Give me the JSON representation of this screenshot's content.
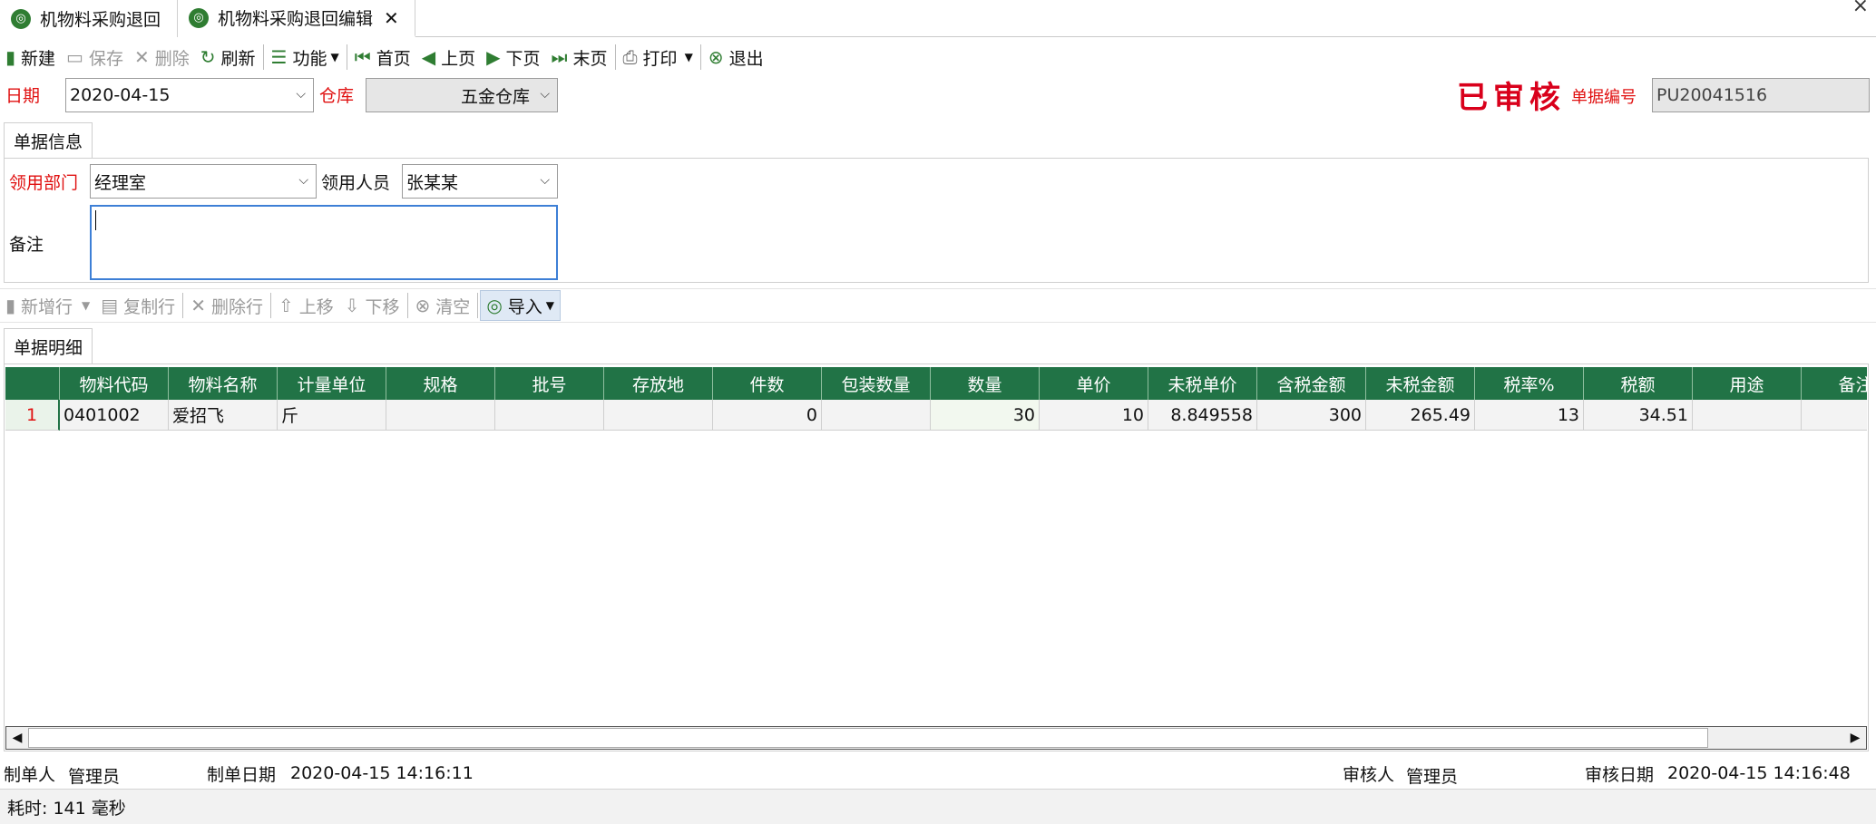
{
  "tabs": [
    {
      "label": "机物料采购退回",
      "active": false
    },
    {
      "label": "机物料采购退回编辑",
      "active": true
    }
  ],
  "toolbar": {
    "new": "新建",
    "save": "保存",
    "delete": "删除",
    "refresh": "刷新",
    "functions": "功能",
    "first": "首页",
    "prev": "上页",
    "next": "下页",
    "last": "末页",
    "print": "打印",
    "exit": "退出"
  },
  "header": {
    "date_label": "日期",
    "date_value": "2020-04-15",
    "warehouse_label": "仓库",
    "warehouse_value": "五金仓库",
    "audited_stamp": "已审核",
    "docno_label": "单据编号",
    "docno_value": "PU20041516"
  },
  "info_section": {
    "tab_label": "单据信息",
    "dept_label": "领用部门",
    "dept_value": "经理室",
    "person_label": "领用人员",
    "person_value": "张某某",
    "remark_label": "备注",
    "remark_value": ""
  },
  "grid_toolbar": {
    "add_row": "新增行",
    "copy_row": "复制行",
    "delete_row": "删除行",
    "move_up": "上移",
    "move_down": "下移",
    "clear": "清空",
    "import": "导入"
  },
  "detail_section": {
    "tab_label": "单据明细",
    "columns": [
      "物料代码",
      "物料名称",
      "计量单位",
      "规格",
      "批号",
      "存放地",
      "件数",
      "包装数量",
      "数量",
      "单价",
      "未税单价",
      "含税金额",
      "未税金额",
      "税率%",
      "税额",
      "用途",
      "备注"
    ],
    "rows": [
      {
        "index": "1",
        "cells": [
          "0401002",
          "爱招飞",
          "斤",
          "",
          "",
          "",
          "0",
          "",
          "30",
          "10",
          "8.849558",
          "300",
          "265.49",
          "13",
          "34.51",
          "",
          ""
        ]
      }
    ]
  },
  "footer": {
    "creator_label": "制单人",
    "creator_value": "管理员",
    "created_label": "制单日期",
    "created_value": "2020-04-15 14:16:11",
    "auditor_label": "审核人",
    "auditor_value": "管理员",
    "audit_date_label": "审核日期",
    "audit_date_value": "2020-04-15 14:16:48"
  },
  "status": {
    "elapsed": "耗时: 141 毫秒"
  },
  "colors": {
    "grid_header": "#217346",
    "accent_red": "#e01010",
    "stamp_red": "#d9001b"
  }
}
